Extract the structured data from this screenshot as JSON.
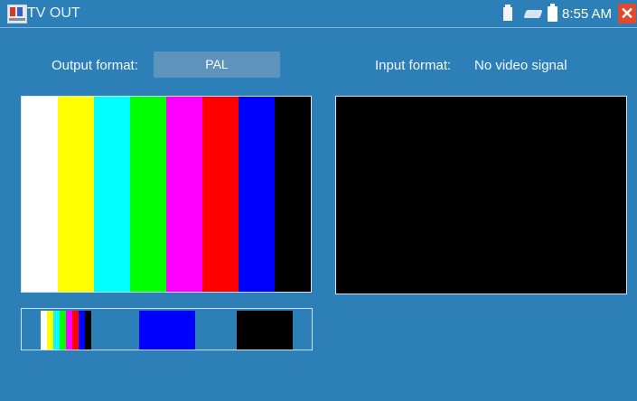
{
  "window": {
    "title": "TV OUT"
  },
  "status_bar": {
    "icons": [
      "sd-card-icon",
      "usb-icon",
      "battery-icon"
    ],
    "time": "8:55 AM",
    "close_glyph": "✕"
  },
  "output": {
    "label": "Output format:",
    "value": "PAL"
  },
  "input": {
    "label": "Input format:",
    "value": "No video signal"
  },
  "test_pattern": {
    "bar_colors": [
      "#ffffff",
      "#ffff00",
      "#00ffff",
      "#00ff00",
      "#ff00ff",
      "#ff0000",
      "#0000ff",
      "#000000"
    ]
  },
  "pattern_options": [
    {
      "name": "color-bars",
      "colors": [
        "#ffffff",
        "#ffff00",
        "#00ffff",
        "#00ff00",
        "#ff00ff",
        "#ff0000",
        "#0000ff",
        "#000000"
      ]
    },
    {
      "name": "solid-blue",
      "color": "#0000ff"
    },
    {
      "name": "solid-black",
      "color": "#000000"
    }
  ],
  "theme": {
    "background": "#2d7fb8",
    "accent": "#5d93bd"
  }
}
